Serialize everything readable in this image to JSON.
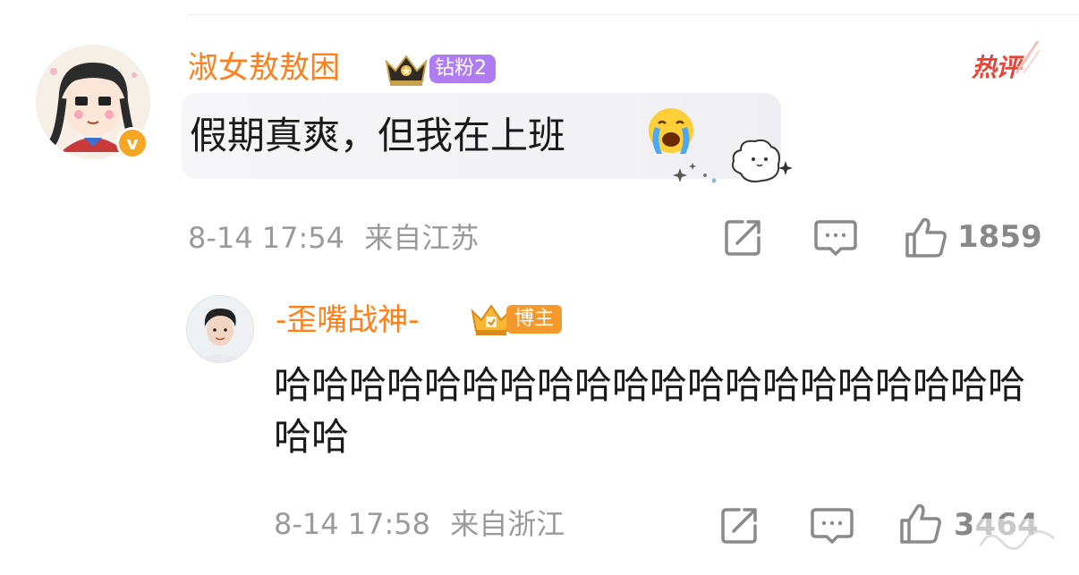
{
  "comment": {
    "username": "淑女敖敖困",
    "fan_badge": "钻粉2",
    "hot_label": "热评",
    "text": "假期真爽，但我在上班",
    "timestamp": "8-14 17:54",
    "location": "来自江苏",
    "like_count": "1859",
    "icons": [
      "avatar",
      "verified-badge-icon",
      "crown-icon",
      "crying-emoji-icon",
      "share-icon",
      "comment-icon",
      "like-icon"
    ]
  },
  "reply": {
    "username": "-歪嘴战神-",
    "role_badge": "博主",
    "text": "哈哈哈哈哈哈哈哈哈哈哈哈哈哈哈哈哈哈哈哈哈哈",
    "timestamp": "8-14 17:58",
    "location": "来自浙江",
    "like_count": "3464",
    "icons": [
      "avatar",
      "crown-icon",
      "share-icon",
      "comment-icon",
      "like-icon"
    ]
  },
  "colors": {
    "username": "#ff7f1a",
    "fan_badge_bg": "#b07cf4",
    "blogger_badge_bg": "#f49a2c",
    "hot_label": "#e6463a",
    "meta_text": "#9a9a9a"
  }
}
